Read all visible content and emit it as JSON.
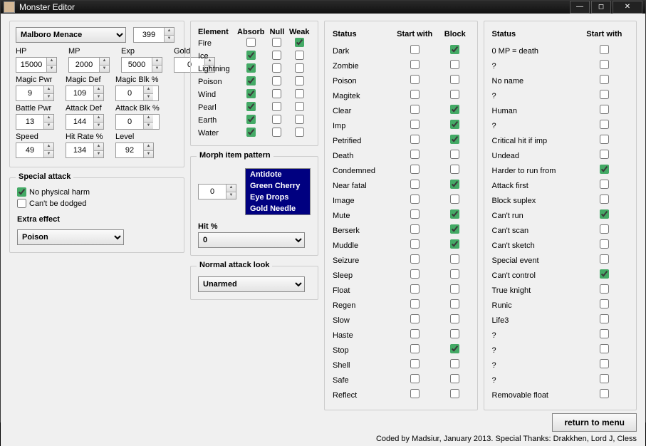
{
  "window": {
    "title": "Monster Editor"
  },
  "monster": {
    "name": "Malboro Menace",
    "id": 399
  },
  "stats": {
    "hp": {
      "label": "HP",
      "value": 15000
    },
    "mp": {
      "label": "MP",
      "value": 2000
    },
    "exp": {
      "label": "Exp",
      "value": 5000
    },
    "gold": {
      "label": "Gold",
      "value": 0
    },
    "magicPwr": {
      "label": "Magic Pwr",
      "value": 9
    },
    "magicDef": {
      "label": "Magic Def",
      "value": 109
    },
    "magicBlk": {
      "label": "Magic Blk %",
      "value": 0
    },
    "battlePwr": {
      "label": "Battle Pwr",
      "value": 13
    },
    "attackDef": {
      "label": "Attack Def",
      "value": 144
    },
    "attackBlk": {
      "label": "Attack Blk %",
      "value": 0
    },
    "speed": {
      "label": "Speed",
      "value": 49
    },
    "hitRate": {
      "label": "Hit Rate %",
      "value": 134
    },
    "level": {
      "label": "Level",
      "value": 92
    }
  },
  "specialAttack": {
    "title": "Special attack",
    "noPhysical": {
      "label": "No physical harm",
      "checked": true
    },
    "cantDodge": {
      "label": "Can't be dodged",
      "checked": false
    },
    "extraEffectLabel": "Extra effect",
    "extraEffect": "Poison"
  },
  "elements": {
    "headers": [
      "Element",
      "Absorb",
      "Null",
      "Weak"
    ],
    "rows": [
      {
        "name": "Fire",
        "absorb": false,
        "null": false,
        "weak": true
      },
      {
        "name": "Ice",
        "absorb": true,
        "null": false,
        "weak": false
      },
      {
        "name": "Lightning",
        "absorb": true,
        "null": false,
        "weak": false
      },
      {
        "name": "Poison",
        "absorb": true,
        "null": false,
        "weak": false
      },
      {
        "name": "Wind",
        "absorb": true,
        "null": false,
        "weak": false
      },
      {
        "name": "Pearl",
        "absorb": true,
        "null": false,
        "weak": false
      },
      {
        "name": "Earth",
        "absorb": true,
        "null": false,
        "weak": false
      },
      {
        "name": "Water",
        "absorb": true,
        "null": false,
        "weak": false
      }
    ]
  },
  "morph": {
    "title": "Morph item pattern",
    "index": 0,
    "items": [
      "Antidote",
      "Green Cherry",
      "Eye Drops",
      "Gold Needle"
    ],
    "hitLabel": "Hit %",
    "hit": "0"
  },
  "normalAttack": {
    "title": "Normal attack look",
    "value": "Unarmed"
  },
  "status1": {
    "headers": [
      "Status",
      "Start with",
      "Block"
    ],
    "rows": [
      {
        "name": "Dark",
        "start": false,
        "block": true
      },
      {
        "name": "Zombie",
        "start": false,
        "block": false
      },
      {
        "name": "Poison",
        "start": false,
        "block": false
      },
      {
        "name": "Magitek",
        "start": false,
        "block": false
      },
      {
        "name": "Clear",
        "start": false,
        "block": true
      },
      {
        "name": "Imp",
        "start": false,
        "block": true
      },
      {
        "name": "Petrified",
        "start": false,
        "block": true
      },
      {
        "name": "Death",
        "start": false,
        "block": false
      },
      {
        "name": "Condemned",
        "start": false,
        "block": false
      },
      {
        "name": "Near fatal",
        "start": false,
        "block": true
      },
      {
        "name": "Image",
        "start": false,
        "block": false
      },
      {
        "name": "Mute",
        "start": false,
        "block": true
      },
      {
        "name": "Berserk",
        "start": false,
        "block": true
      },
      {
        "name": "Muddle",
        "start": false,
        "block": true
      },
      {
        "name": "Seizure",
        "start": false,
        "block": false
      },
      {
        "name": "Sleep",
        "start": false,
        "block": false
      },
      {
        "name": "Float",
        "start": false,
        "block": false
      },
      {
        "name": "Regen",
        "start": false,
        "block": false
      },
      {
        "name": "Slow",
        "start": false,
        "block": false
      },
      {
        "name": "Haste",
        "start": false,
        "block": false
      },
      {
        "name": "Stop",
        "start": false,
        "block": true
      },
      {
        "name": "Shell",
        "start": false,
        "block": false
      },
      {
        "name": "Safe",
        "start": false,
        "block": false
      },
      {
        "name": "Reflect",
        "start": false,
        "block": false
      }
    ]
  },
  "status2": {
    "headers": [
      "Status",
      "Start with"
    ],
    "rows": [
      {
        "name": "0 MP = death",
        "start": false
      },
      {
        "name": "?",
        "start": false
      },
      {
        "name": "No name",
        "start": false
      },
      {
        "name": "?",
        "start": false
      },
      {
        "name": "Human",
        "start": false
      },
      {
        "name": "?",
        "start": false
      },
      {
        "name": "Critical hit if imp",
        "start": false
      },
      {
        "name": "Undead",
        "start": false
      },
      {
        "name": "Harder to run from",
        "start": true
      },
      {
        "name": "Attack first",
        "start": false
      },
      {
        "name": "Block suplex",
        "start": false
      },
      {
        "name": "Can't run",
        "start": true
      },
      {
        "name": "Can't scan",
        "start": false
      },
      {
        "name": "Can't sketch",
        "start": false
      },
      {
        "name": "Special event",
        "start": false
      },
      {
        "name": "Can't control",
        "start": true
      },
      {
        "name": "True knight",
        "start": false
      },
      {
        "name": "Runic",
        "start": false
      },
      {
        "name": "Life3",
        "start": false
      },
      {
        "name": "?",
        "start": false
      },
      {
        "name": "?",
        "start": false
      },
      {
        "name": "?",
        "start": false
      },
      {
        "name": "?",
        "start": false
      },
      {
        "name": "Removable float",
        "start": false
      }
    ]
  },
  "footer": {
    "returnLabel": "return to menu",
    "credits": "Coded by Madsiur, January 2013. Special Thanks: Drakkhen, Lord J,  Cless"
  }
}
